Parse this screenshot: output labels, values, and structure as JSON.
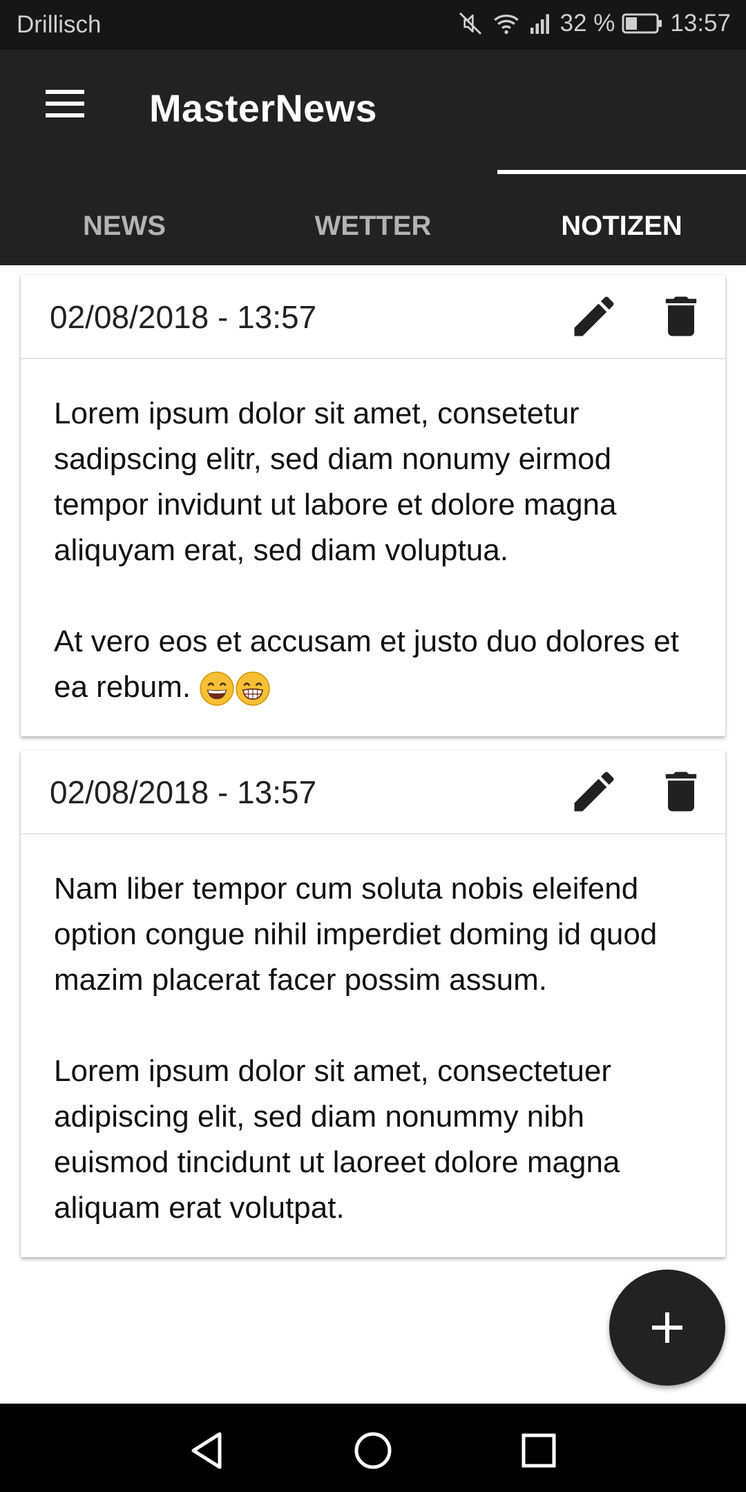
{
  "status_bar": {
    "carrier": "Drillisch",
    "battery": "32 %",
    "time": "13:57",
    "icons": [
      "mute-icon",
      "wifi-icon",
      "signal-icon",
      "battery-icon"
    ]
  },
  "app_bar": {
    "title": "MasterNews",
    "menu_icon": "menu-icon"
  },
  "tabs": [
    {
      "label": "NEWS",
      "active": false
    },
    {
      "label": "WETTER",
      "active": false
    },
    {
      "label": "NOTIZEN",
      "active": true
    }
  ],
  "notes": [
    {
      "date": "02/08/2018 - 13:57",
      "paragraphs": [
        "Lorem ipsum dolor sit amet, consetetur sadipscing elitr, sed diam nonumy eirmod tempor invidunt ut labore et dolore magna aliquyam erat, sed diam voluptua.",
        "At vero eos et accusam et justo duo dolores et ea rebum."
      ],
      "emoji": [
        "grinning-face-emoji",
        "grimacing-face-emoji"
      ]
    },
    {
      "date": "02/08/2018 - 13:57",
      "paragraphs": [
        "Nam liber tempor cum soluta nobis eleifend option congue nihil imperdiet doming id quod mazim placerat facer possim assum.",
        "Lorem ipsum dolor sit amet, consectetuer adipiscing elit, sed diam nonummy nibh euismod tincidunt ut laoreet dolore magna aliquam erat volutpat."
      ]
    }
  ],
  "card_icons": {
    "edit": "pencil-icon",
    "delete": "trash-icon"
  },
  "fab": {
    "icon": "plus-icon"
  },
  "nav_bar": {
    "icons": [
      "back-triangle-icon",
      "home-circle-icon",
      "recents-square-icon"
    ]
  },
  "colors": {
    "app_bar": "#222222",
    "status_bar": "#161616",
    "accent": "#ffffff"
  }
}
